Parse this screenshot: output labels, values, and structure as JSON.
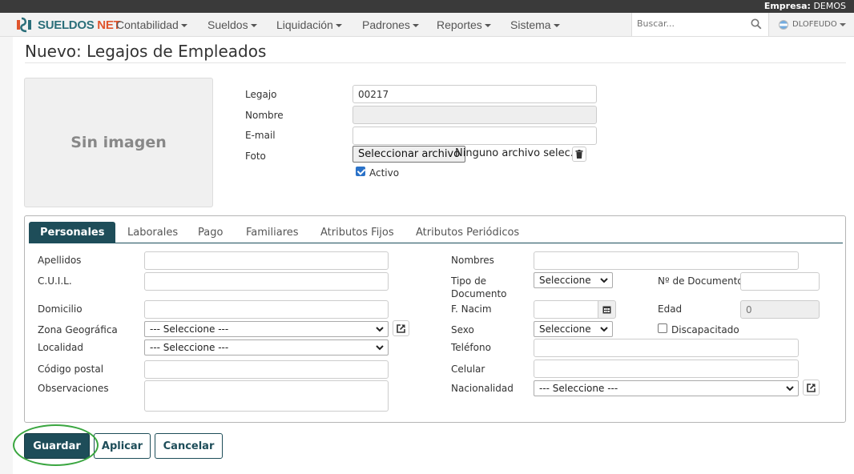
{
  "company_bar": {
    "label": "Empresa:",
    "value": "DEMOS"
  },
  "brand": {
    "name_part1": "SUELDOS",
    "name_part2": "NET"
  },
  "nav": [
    {
      "label": "Contabilidad"
    },
    {
      "label": "Sueldos"
    },
    {
      "label": "Liquidación"
    },
    {
      "label": "Padrones"
    },
    {
      "label": "Reportes"
    },
    {
      "label": "Sistema"
    }
  ],
  "search": {
    "placeholder": "Buscar..."
  },
  "user": {
    "name": "DLOFEUDO"
  },
  "page_title": "Nuevo: Legajos de Empleados",
  "photo_placeholder": "Sin imagen",
  "header_form": {
    "legajo_label": "Legajo",
    "legajo_value": "00217",
    "nombre_label": "Nombre",
    "email_label": "E-mail",
    "foto_label": "Foto",
    "file_button": "Seleccionar archivo",
    "file_status": "Ninguno archivo selec.",
    "activo_label": "Activo"
  },
  "tabs": [
    {
      "label": "Personales"
    },
    {
      "label": "Laborales"
    },
    {
      "label": "Pago"
    },
    {
      "label": "Familiares"
    },
    {
      "label": "Atributos Fijos"
    },
    {
      "label": "Atributos Periódicos"
    }
  ],
  "personales": {
    "apellidos": "Apellidos",
    "cuil": "C.U.I.L.",
    "domicilio": "Domicilio",
    "zona": "Zona Geográfica",
    "zona_value": "--- Seleccione ---",
    "localidad": "Localidad",
    "localidad_value": "--- Seleccione ---",
    "codigo_postal": "Código postal",
    "observaciones": "Observaciones",
    "nombres": "Nombres",
    "tipo_doc_line1": "Tipo de",
    "tipo_doc_line2": "Documento",
    "tipo_doc_value": "Seleccione",
    "nro_doc": "Nº de Documento",
    "f_nacim": "F. Nacim",
    "edad": "Edad",
    "edad_value": "0",
    "sexo": "Sexo",
    "sexo_value": "Seleccione",
    "discapacitado": "Discapacitado",
    "telefono": "Teléfono",
    "celular": "Celular",
    "nacionalidad": "Nacionalidad",
    "nacionalidad_value": "--- Seleccione ---"
  },
  "actions": {
    "save": "Guardar",
    "apply": "Aplicar",
    "cancel": "Cancelar"
  },
  "colors": {
    "primary": "#1e4d59",
    "brand_teal": "#2b6f7a",
    "brand_orange": "#e0552d",
    "highlight": "#3aa640"
  }
}
